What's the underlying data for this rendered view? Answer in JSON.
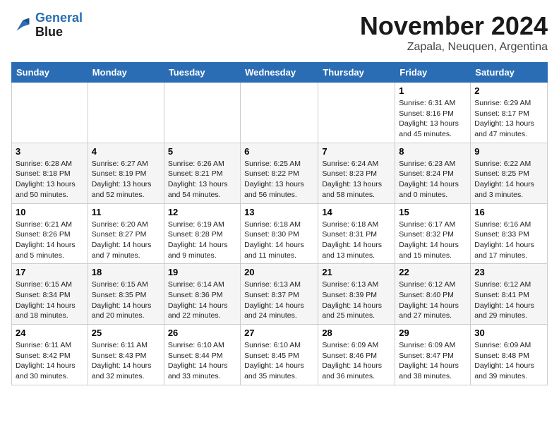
{
  "logo": {
    "line1": "General",
    "line2": "Blue"
  },
  "title": "November 2024",
  "location": "Zapala, Neuquen, Argentina",
  "weekdays": [
    "Sunday",
    "Monday",
    "Tuesday",
    "Wednesday",
    "Thursday",
    "Friday",
    "Saturday"
  ],
  "weeks": [
    [
      {
        "num": "",
        "info": ""
      },
      {
        "num": "",
        "info": ""
      },
      {
        "num": "",
        "info": ""
      },
      {
        "num": "",
        "info": ""
      },
      {
        "num": "",
        "info": ""
      },
      {
        "num": "1",
        "info": "Sunrise: 6:31 AM\nSunset: 8:16 PM\nDaylight: 13 hours and 45 minutes."
      },
      {
        "num": "2",
        "info": "Sunrise: 6:29 AM\nSunset: 8:17 PM\nDaylight: 13 hours and 47 minutes."
      }
    ],
    [
      {
        "num": "3",
        "info": "Sunrise: 6:28 AM\nSunset: 8:18 PM\nDaylight: 13 hours and 50 minutes."
      },
      {
        "num": "4",
        "info": "Sunrise: 6:27 AM\nSunset: 8:19 PM\nDaylight: 13 hours and 52 minutes."
      },
      {
        "num": "5",
        "info": "Sunrise: 6:26 AM\nSunset: 8:21 PM\nDaylight: 13 hours and 54 minutes."
      },
      {
        "num": "6",
        "info": "Sunrise: 6:25 AM\nSunset: 8:22 PM\nDaylight: 13 hours and 56 minutes."
      },
      {
        "num": "7",
        "info": "Sunrise: 6:24 AM\nSunset: 8:23 PM\nDaylight: 13 hours and 58 minutes."
      },
      {
        "num": "8",
        "info": "Sunrise: 6:23 AM\nSunset: 8:24 PM\nDaylight: 14 hours and 0 minutes."
      },
      {
        "num": "9",
        "info": "Sunrise: 6:22 AM\nSunset: 8:25 PM\nDaylight: 14 hours and 3 minutes."
      }
    ],
    [
      {
        "num": "10",
        "info": "Sunrise: 6:21 AM\nSunset: 8:26 PM\nDaylight: 14 hours and 5 minutes."
      },
      {
        "num": "11",
        "info": "Sunrise: 6:20 AM\nSunset: 8:27 PM\nDaylight: 14 hours and 7 minutes."
      },
      {
        "num": "12",
        "info": "Sunrise: 6:19 AM\nSunset: 8:28 PM\nDaylight: 14 hours and 9 minutes."
      },
      {
        "num": "13",
        "info": "Sunrise: 6:18 AM\nSunset: 8:30 PM\nDaylight: 14 hours and 11 minutes."
      },
      {
        "num": "14",
        "info": "Sunrise: 6:18 AM\nSunset: 8:31 PM\nDaylight: 14 hours and 13 minutes."
      },
      {
        "num": "15",
        "info": "Sunrise: 6:17 AM\nSunset: 8:32 PM\nDaylight: 14 hours and 15 minutes."
      },
      {
        "num": "16",
        "info": "Sunrise: 6:16 AM\nSunset: 8:33 PM\nDaylight: 14 hours and 17 minutes."
      }
    ],
    [
      {
        "num": "17",
        "info": "Sunrise: 6:15 AM\nSunset: 8:34 PM\nDaylight: 14 hours and 18 minutes."
      },
      {
        "num": "18",
        "info": "Sunrise: 6:15 AM\nSunset: 8:35 PM\nDaylight: 14 hours and 20 minutes."
      },
      {
        "num": "19",
        "info": "Sunrise: 6:14 AM\nSunset: 8:36 PM\nDaylight: 14 hours and 22 minutes."
      },
      {
        "num": "20",
        "info": "Sunrise: 6:13 AM\nSunset: 8:37 PM\nDaylight: 14 hours and 24 minutes."
      },
      {
        "num": "21",
        "info": "Sunrise: 6:13 AM\nSunset: 8:39 PM\nDaylight: 14 hours and 25 minutes."
      },
      {
        "num": "22",
        "info": "Sunrise: 6:12 AM\nSunset: 8:40 PM\nDaylight: 14 hours and 27 minutes."
      },
      {
        "num": "23",
        "info": "Sunrise: 6:12 AM\nSunset: 8:41 PM\nDaylight: 14 hours and 29 minutes."
      }
    ],
    [
      {
        "num": "24",
        "info": "Sunrise: 6:11 AM\nSunset: 8:42 PM\nDaylight: 14 hours and 30 minutes."
      },
      {
        "num": "25",
        "info": "Sunrise: 6:11 AM\nSunset: 8:43 PM\nDaylight: 14 hours and 32 minutes."
      },
      {
        "num": "26",
        "info": "Sunrise: 6:10 AM\nSunset: 8:44 PM\nDaylight: 14 hours and 33 minutes."
      },
      {
        "num": "27",
        "info": "Sunrise: 6:10 AM\nSunset: 8:45 PM\nDaylight: 14 hours and 35 minutes."
      },
      {
        "num": "28",
        "info": "Sunrise: 6:09 AM\nSunset: 8:46 PM\nDaylight: 14 hours and 36 minutes."
      },
      {
        "num": "29",
        "info": "Sunrise: 6:09 AM\nSunset: 8:47 PM\nDaylight: 14 hours and 38 minutes."
      },
      {
        "num": "30",
        "info": "Sunrise: 6:09 AM\nSunset: 8:48 PM\nDaylight: 14 hours and 39 minutes."
      }
    ]
  ]
}
